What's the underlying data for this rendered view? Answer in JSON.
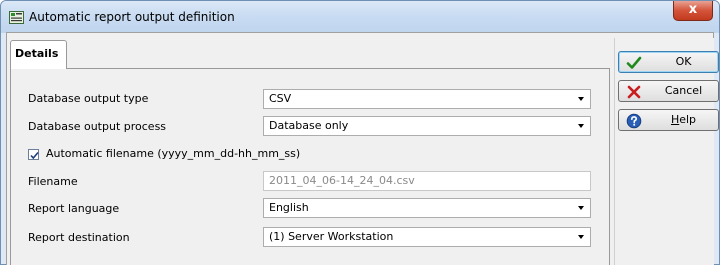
{
  "window": {
    "title": "Automatic report output definition",
    "close_label": "x"
  },
  "tabs": [
    {
      "label": "Details"
    }
  ],
  "form": {
    "db_output_type": {
      "label": "Database output type",
      "value": "CSV"
    },
    "db_output_process": {
      "label": "Database output process",
      "value": "Database only"
    },
    "auto_filename": {
      "label": "Automatic filename (yyyy_mm_dd-hh_mm_ss)",
      "checked": true
    },
    "filename": {
      "label": "Filename",
      "value": "2011_04_06-14_24_04.csv"
    },
    "report_language": {
      "label": "Report language",
      "value": "English"
    },
    "report_destination": {
      "label": "Report destination",
      "value": "(1)  Server Workstation"
    }
  },
  "buttons": {
    "ok": {
      "label": "OK",
      "icon": "checkmark-icon",
      "color": "#1e8a1e"
    },
    "cancel": {
      "label": "Cancel",
      "icon": "cross-icon",
      "color": "#c81e1e"
    },
    "help": {
      "label_pre": "",
      "label_underline": "H",
      "label_post": "elp",
      "icon": "help-icon",
      "color": "#2a5fb8"
    }
  }
}
